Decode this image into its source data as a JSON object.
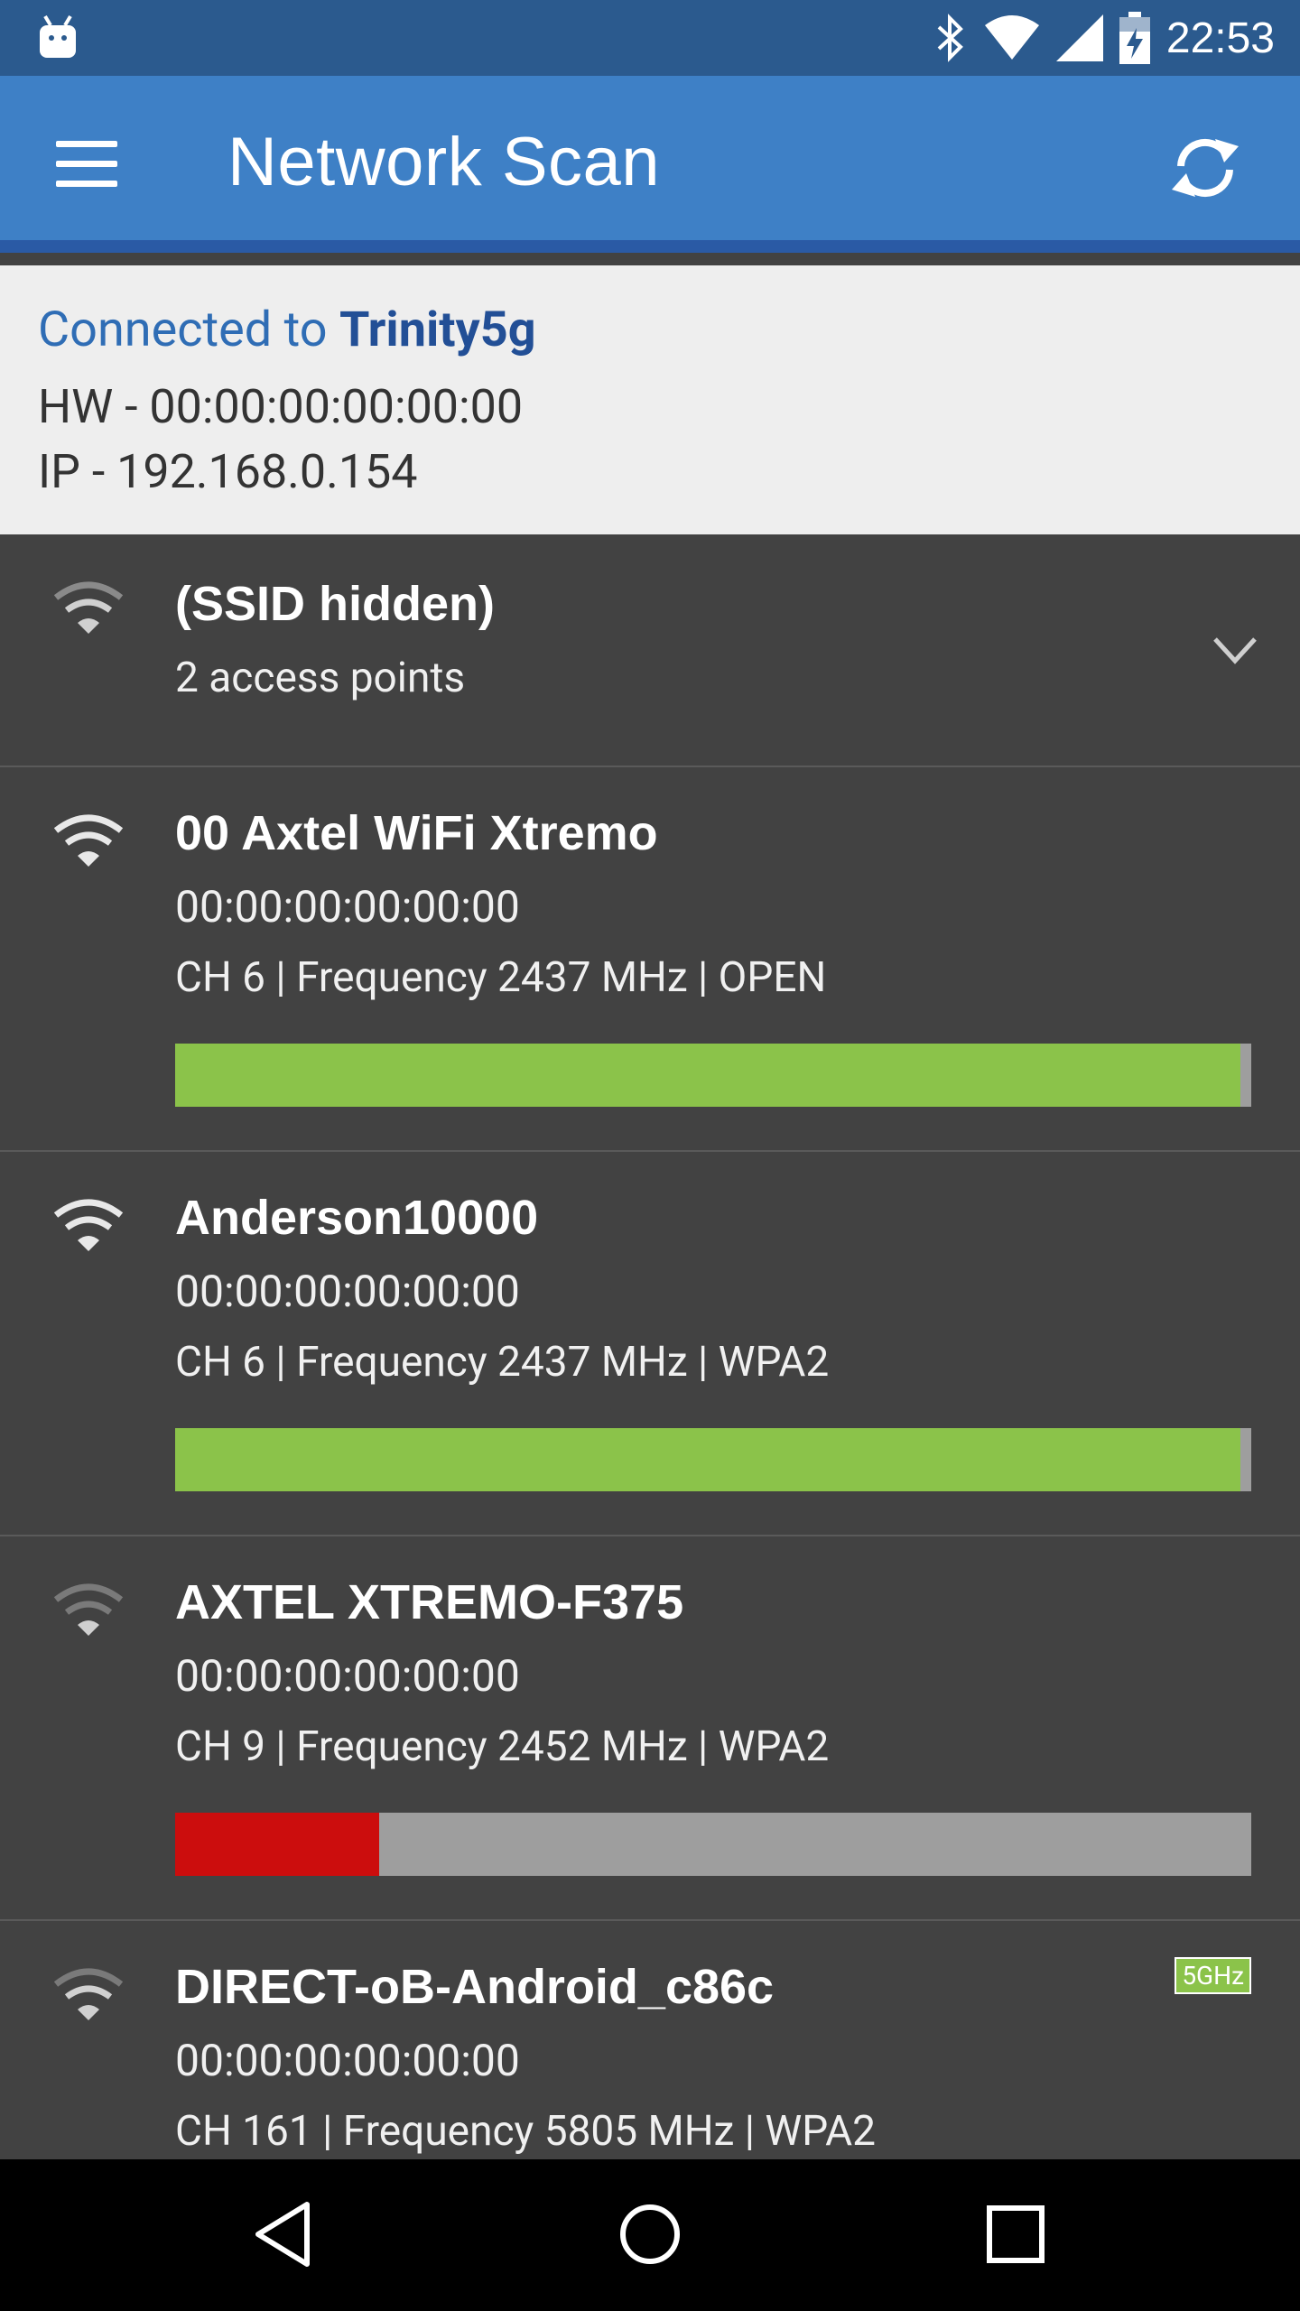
{
  "status_bar": {
    "time": "22:53",
    "icons": [
      "android-icon",
      "bluetooth-icon",
      "wifi-icon",
      "cell-signal-icon",
      "battery-charging-icon"
    ]
  },
  "app_bar": {
    "title": "Network Scan",
    "menu_icon": "hamburger-menu-icon",
    "refresh_icon": "refresh-icon"
  },
  "connection": {
    "connected_prefix": "Connected to ",
    "ssid": "Trinity5g",
    "hw": "HW - 00:00:00:00:00:00",
    "ip": "IP - 192.168.0.154",
    "colors": {
      "prefix": "#2f6db5",
      "ssid": "#224f96"
    }
  },
  "networks": [
    {
      "name": "(SSID hidden)",
      "sub": "2 access points",
      "type": "group",
      "signal_icon": "wifi-medium-icon"
    },
    {
      "name": "00 Axtel WiFi Xtremo",
      "mac": "00:00:00:00:00:00",
      "detail": "CH 6 | Frequency 2437 MHz | OPEN",
      "signal_fraction": 0.99,
      "bar_color": "#8bc34a",
      "signal_icon": "wifi-strong-icon"
    },
    {
      "name": "Anderson10000",
      "mac": "00:00:00:00:00:00",
      "detail": "CH 6 | Frequency 2437 MHz | WPA2",
      "signal_fraction": 0.99,
      "bar_color": "#8bc34a",
      "signal_icon": "wifi-strong-icon"
    },
    {
      "name": "AXTEL XTREMO-F375",
      "mac": "00:00:00:00:00:00",
      "detail": "CH 9 | Frequency 2452 MHz | WPA2",
      "signal_fraction": 0.19,
      "bar_color": "#cc0d0d",
      "signal_icon": "wifi-weak-icon"
    },
    {
      "name": "DIRECT-oB-Android_c86c",
      "mac": "00:00:00:00:00:00",
      "detail": "CH 161 | Frequency 5805 MHz | WPA2",
      "badge": "5GHz",
      "signal_icon": "wifi-weak-icon"
    }
  ],
  "nav_bar": {
    "back_icon": "back-triangle-icon",
    "home_icon": "home-circle-icon",
    "recents_icon": "recents-square-icon"
  }
}
